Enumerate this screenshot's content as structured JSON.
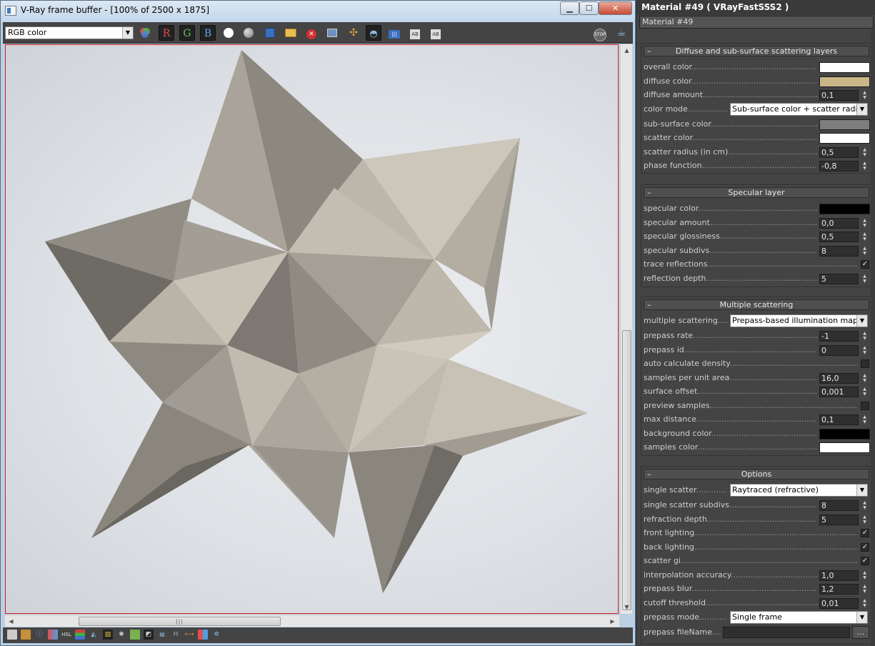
{
  "vfb": {
    "title": "V-Ray frame buffer - [100% of 2500 x 1875]",
    "channel": "RGB color",
    "channel_buttons": [
      "R",
      "G",
      "B"
    ]
  },
  "colors": {
    "overall_color": "#ffffff",
    "diffuse_color": "#cab787",
    "subsurface_color": "#7e7e7e",
    "scatter_color": "#ffffff",
    "specular_color": "#000000",
    "background_color": "#000000",
    "samples_color": "#ffffff"
  },
  "material": {
    "header": "Material #49  ( VRayFastSSS2 )",
    "name": "Material #49",
    "rollouts": {
      "diffuse": {
        "title": "Diffuse and sub-surface scattering layers",
        "overall_color": "overall color",
        "diffuse_color": "diffuse color",
        "diffuse_amount": "diffuse amount",
        "diffuse_amount_val": "0,1",
        "color_mode": "color mode",
        "color_mode_val": "Sub-surface color + scatter radius",
        "subsurface_color": "sub-surface color",
        "scatter_color": "scatter color",
        "scatter_radius": "scatter radius (in cm)",
        "scatter_radius_val": "0,5",
        "phase_function": "phase function",
        "phase_function_val": "-0,8"
      },
      "specular": {
        "title": "Specular layer",
        "specular_color": "specular color",
        "specular_amount": "specular amount",
        "specular_amount_val": "0,0",
        "specular_glossiness": "specular glossiness",
        "specular_glossiness_val": "0,5",
        "specular_subdivs": "specular subdivs",
        "specular_subdivs_val": "8",
        "trace_reflections": "trace reflections",
        "trace_reflections_checked": true,
        "reflection_depth": "reflection depth",
        "reflection_depth_val": "5"
      },
      "multiple": {
        "title": "Multiple scattering",
        "multiple_scattering": "multiple scattering",
        "multiple_scattering_val": "Prepass-based illumination map",
        "prepass_rate": "prepass rate",
        "prepass_rate_val": "-1",
        "prepass_id": "prepass id",
        "prepass_id_val": "0",
        "auto_calc_density": "auto calculate density",
        "auto_calc_density_checked": false,
        "samples_per_unit_area": "samples per unit area",
        "samples_per_unit_area_val": "16,0",
        "surface_offset": "surface offset",
        "surface_offset_val": "0,001",
        "preview_samples": "preview samples",
        "preview_samples_checked": false,
        "max_distance": "max distance",
        "max_distance_val": "0,1",
        "background_color": "background color",
        "samples_color": "samples color"
      },
      "options": {
        "title": "Options",
        "single_scatter": "single scatter",
        "single_scatter_val": "Raytraced (refractive)",
        "single_scatter_subdivs": "single scatter subdivs",
        "single_scatter_subdivs_val": "8",
        "refraction_depth": "refraction depth",
        "refraction_depth_val": "5",
        "front_lighting": "front lighting",
        "front_lighting_checked": true,
        "back_lighting": "back lighting",
        "back_lighting_checked": true,
        "scatter_gi": "scatter gi",
        "scatter_gi_checked": true,
        "interpolation_accuracy": "interpolation accuracy",
        "interpolation_accuracy_val": "1,0",
        "prepass_blur": "prepass blur",
        "prepass_blur_val": "1,2",
        "cutoff_threshold": "cutoff threshold",
        "cutoff_threshold_val": "0,01",
        "prepass_mode": "prepass mode",
        "prepass_mode_val": "Single frame",
        "prepass_filename": "prepass fileName",
        "browse": "..."
      }
    }
  }
}
